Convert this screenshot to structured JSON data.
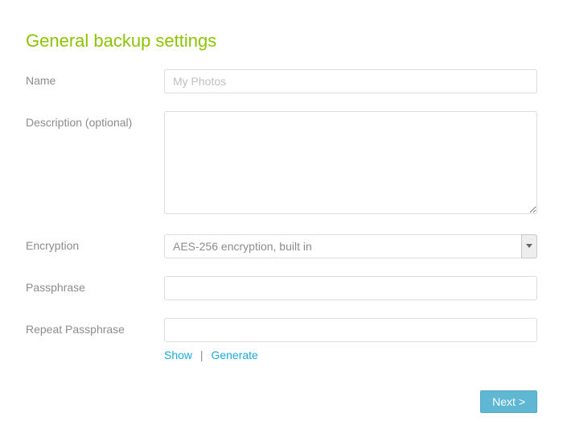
{
  "title": "General backup settings",
  "labels": {
    "name": "Name",
    "description": "Description (optional)",
    "encryption": "Encryption",
    "passphrase": "Passphrase",
    "repeat_passphrase": "Repeat Passphrase"
  },
  "fields": {
    "name_placeholder": "My Photos",
    "name_value": "",
    "description_value": "",
    "encryption_selected": "AES-256 encryption, built in",
    "passphrase_value": "",
    "repeat_passphrase_value": ""
  },
  "links": {
    "show": "Show",
    "separator": "|",
    "generate": "Generate"
  },
  "buttons": {
    "next": "Next >"
  }
}
